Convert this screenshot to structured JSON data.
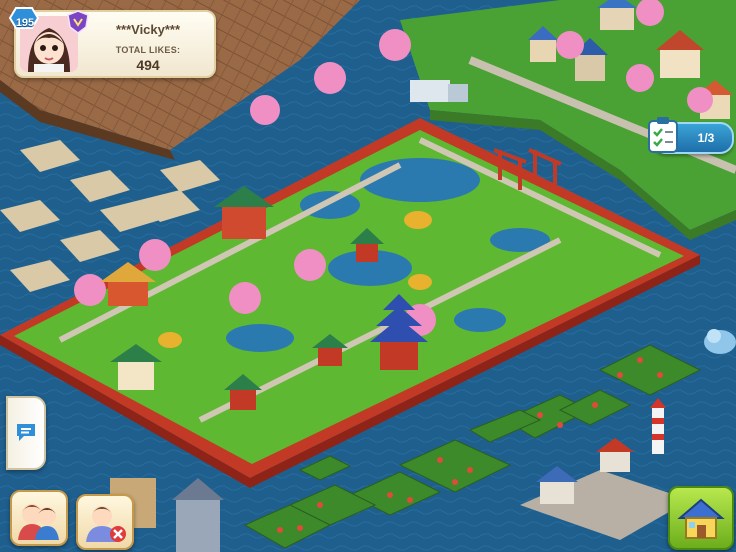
{
  "player": {
    "level": "195",
    "name": "***Vicky***",
    "likes_label": "TOTAL LIKES:",
    "likes_count": "494",
    "avatar_icon": "girl-avatar-icon",
    "vip_icon": "purple-shield-badge-icon"
  },
  "quest": {
    "progress_text": "1/3",
    "icon": "clipboard-checklist-icon",
    "completed": 1,
    "total": 3
  },
  "hud": {
    "chat_icon": "speech-bubble-icon",
    "friends_icon": "friends-couple-icon",
    "unfriend_icon": "remove-friend-icon",
    "home_icon": "home-house-icon"
  },
  "colors": {
    "water": "#1f5f8e",
    "grass": "#5fb832",
    "pier_red": "#c23a26",
    "level_badge": "#2f8fd8",
    "home_button": "#7dc423"
  }
}
